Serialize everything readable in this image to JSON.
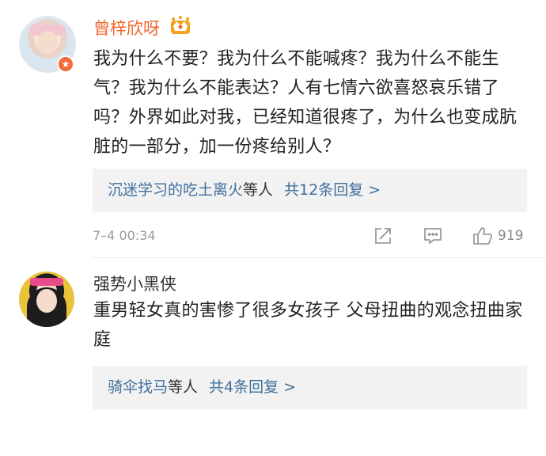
{
  "comments": [
    {
      "username": "曾梓欣呀",
      "text": "我为什么不要？我为什么不能喊疼？我为什么不能生气？我为什么不能表达？人有七情六欲喜怒哀乐错了吗？外界如此对我，已经知道很疼了，为什么也变成肮脏的一部分，加一份疼给别人？",
      "replies": {
        "who": "沉迷学习的吃土离火",
        "suffix": "等人",
        "count_label": "共12条回复 >"
      },
      "time": "7–4 00:34",
      "likes": "919",
      "badge_color": "#f46a3a"
    },
    {
      "username": "强势小黑侠",
      "text": "重男轻女真的害惨了很多女孩子 父母扭曲的观念扭曲家庭",
      "replies": {
        "who": "骑伞找马",
        "suffix": "等人",
        "count_label": "共4条回复 >"
      }
    }
  ],
  "icons": {
    "crown": "crown-icon",
    "verified": "verified-badge-icon",
    "share": "share-icon",
    "comment": "comment-icon",
    "like": "thumbs-up-icon"
  },
  "colors": {
    "username_highlight": "#f0672c",
    "link": "#3f6f9d",
    "meta": "#9b9b9b",
    "reply_bg": "#f2f2f2"
  }
}
